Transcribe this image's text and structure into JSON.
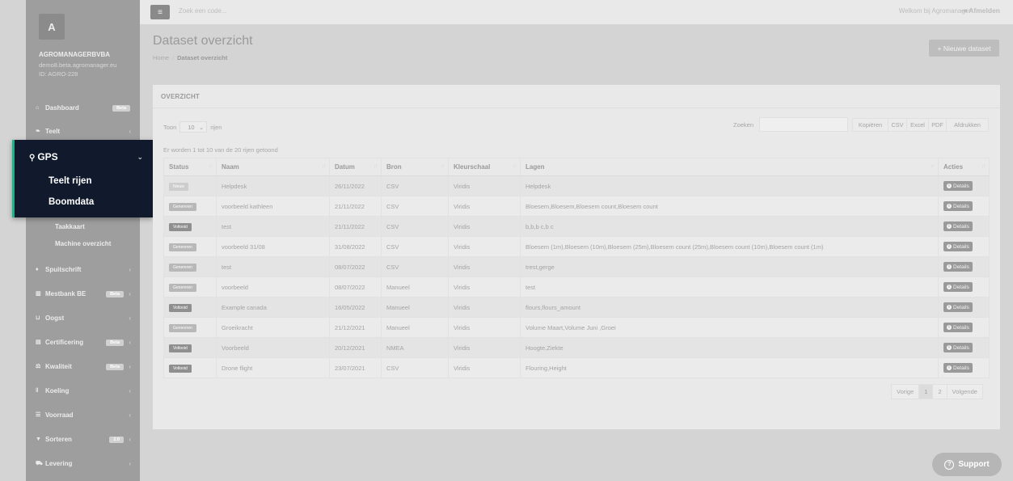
{
  "sidebar": {
    "avatar_letter": "A",
    "company_name": "AGROMANAGERBVBA",
    "company_domain": "demo8.beta.agromanager.eu",
    "company_id": "ID: AGRO-228",
    "items": [
      {
        "label": "Dashboard",
        "icon": "home-icon",
        "badge": "Beta"
      },
      {
        "label": "Teelt",
        "icon": "leaf-icon",
        "chevron": "‹"
      },
      {
        "label": "Spuitschrift",
        "icon": "drop-icon",
        "chevron": "‹"
      },
      {
        "label": "Mestbank BE",
        "icon": "bank-icon",
        "badge": "Beta",
        "chevron": "‹"
      },
      {
        "label": "Oogst",
        "icon": "basket-icon",
        "chevron": "‹"
      },
      {
        "label": "Certificering",
        "icon": "certificate-icon",
        "badge": "Beta",
        "chevron": "‹"
      },
      {
        "label": "Kwaliteit",
        "icon": "balance-icon",
        "badge": "Beta",
        "chevron": "‹"
      },
      {
        "label": "Koeling",
        "icon": "thermometer-icon",
        "chevron": "‹"
      },
      {
        "label": "Voorraad",
        "icon": "list-icon",
        "chevron": "‹"
      },
      {
        "label": "Sorteren",
        "icon": "filter-icon",
        "badge": "2.0",
        "chevron": "‹"
      },
      {
        "label": "Levering",
        "icon": "truck-icon",
        "chevron": "‹"
      }
    ],
    "gps": {
      "label": "GPS",
      "icon": "map-pin-icon",
      "chevron": "⌄",
      "sub_active": [
        "Teelt rijen",
        "Boomdata"
      ],
      "sub_dim": [
        "Taakkaart",
        "Machine overzicht"
      ]
    }
  },
  "topbar": {
    "search_placeholder": "Zoek een code...",
    "welcome": "Welkom bij Agromanager",
    "logout": "Afmelden"
  },
  "header": {
    "title": "Dataset overzicht",
    "breadcrumb_home": "Home",
    "breadcrumb_sep": "/",
    "breadcrumb_current": "Dataset overzicht",
    "new_button": "+ Nieuwe dataset"
  },
  "panel": {
    "title": "OVERZICHT",
    "show_prefix": "Toon",
    "page_size": "10",
    "show_suffix": "rijen",
    "search_label": "Zoeken",
    "export_buttons": [
      "Kopiëren",
      "CSV",
      "Excel",
      "PDF",
      "Afdrukken"
    ],
    "info": "Er worden 1 tot 10 van de 20 rijen getoond",
    "columns": [
      "Status",
      "Naam",
      "Datum",
      "Bron",
      "Kleurschaal",
      "Lagen",
      "Acties"
    ],
    "details_label": "Details",
    "rows": [
      {
        "status": "Nieuw",
        "status_type": "nieuw",
        "naam": "Helpdesk",
        "datum": "26/11/2022",
        "bron": "CSV",
        "kleurschaal": "Viridis",
        "lagen": "Helpdesk"
      },
      {
        "status": "Genereren",
        "status_type": "gen",
        "naam": "voorbeeld kathleen",
        "datum": "21/11/2022",
        "bron": "CSV",
        "kleurschaal": "Viridis",
        "lagen": "Bloesem,Bloesem,Bloesem count,Bloesem count"
      },
      {
        "status": "Voltooid",
        "status_type": "vol",
        "naam": "test",
        "datum": "21/11/2022",
        "bron": "CSV",
        "kleurschaal": "Viridis",
        "lagen": "b,b,b c,b c"
      },
      {
        "status": "Genereren",
        "status_type": "gen",
        "naam": "voorbeeld 31/08",
        "datum": "31/08/2022",
        "bron": "CSV",
        "kleurschaal": "Viridis",
        "lagen": "Bloesem (1m),Bloesem (10m),Bloesem (25m),Bloesem count (25m),Bloesem count (10m),Bloesem count (1m)"
      },
      {
        "status": "Genereren",
        "status_type": "gen",
        "naam": "test",
        "datum": "08/07/2022",
        "bron": "CSV",
        "kleurschaal": "Viridis",
        "lagen": "trest,gerge"
      },
      {
        "status": "Genereren",
        "status_type": "gen",
        "naam": "voorbeeld",
        "datum": "08/07/2022",
        "bron": "Manueel",
        "kleurschaal": "Viridis",
        "lagen": "test"
      },
      {
        "status": "Voltooid",
        "status_type": "vol",
        "naam": "Example canada",
        "datum": "16/05/2022",
        "bron": "Manueel",
        "kleurschaal": "Viridis",
        "lagen": "flours,flours_amount"
      },
      {
        "status": "Genereren",
        "status_type": "gen",
        "naam": "Groeikracht",
        "datum": "21/12/2021",
        "bron": "Manueel",
        "kleurschaal": "Viridis",
        "lagen": "Volume Maart,Volume Juni ,Groei"
      },
      {
        "status": "Voltooid",
        "status_type": "vol",
        "naam": "Voorbeeld",
        "datum": "20/12/2021",
        "bron": "NMEA",
        "kleurschaal": "Viridis",
        "lagen": "Hoogte,Ziekte"
      },
      {
        "status": "Voltooid",
        "status_type": "vol",
        "naam": "Drone flight",
        "datum": "23/07/2021",
        "bron": "CSV",
        "kleurschaal": "Viridis",
        "lagen": "Flouring,Height"
      }
    ],
    "pagination": {
      "prev": "Vorige",
      "pages": [
        "1",
        "2"
      ],
      "active_page": "1",
      "next": "Volgende"
    }
  },
  "support_label": "Support",
  "colors": {
    "gps_bg": "#111a2c",
    "gps_accent": "#1bb489",
    "sidebar_bg": "#9e9e9e"
  }
}
